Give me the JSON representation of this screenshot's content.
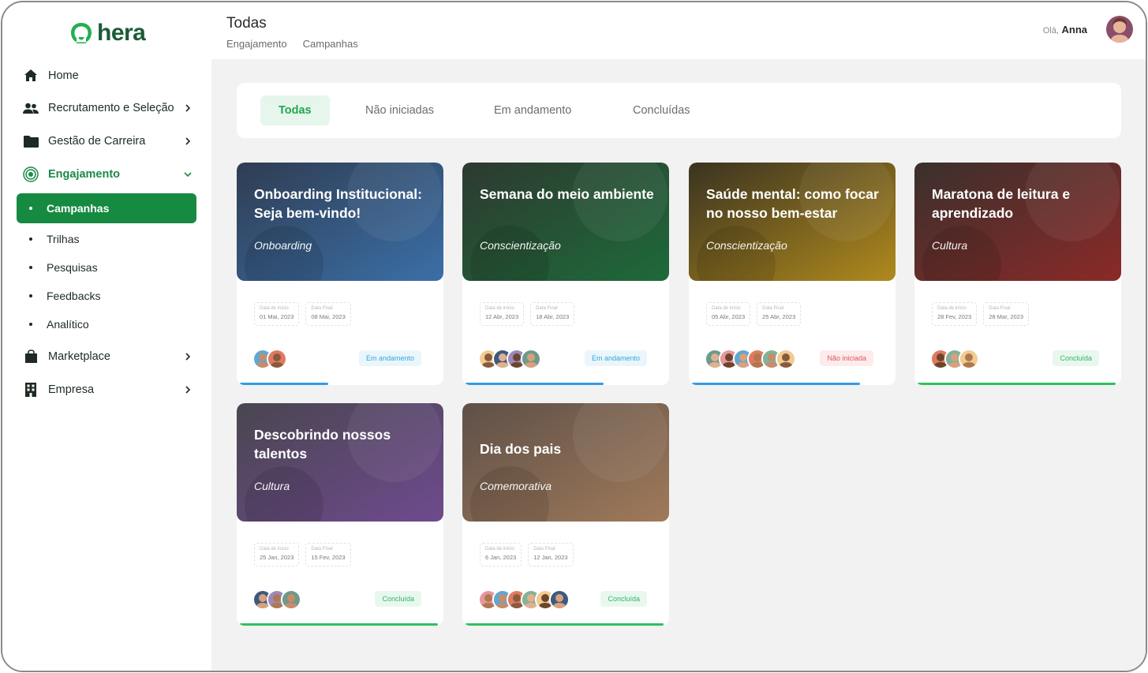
{
  "brand": {
    "name": "hera",
    "color": "#1a5c36",
    "accent": "#178a42"
  },
  "sidebar": {
    "items": [
      {
        "label": "Home",
        "icon": "home-icon"
      },
      {
        "label": "Recrutamento e Seleção",
        "icon": "users-icon"
      },
      {
        "label": "Gestão de Carreira",
        "icon": "folder-icon"
      },
      {
        "label": "Engajamento",
        "icon": "target-icon"
      },
      {
        "label": "Marketplace",
        "icon": "bag-icon"
      },
      {
        "label": "Empresa",
        "icon": "building-icon"
      }
    ],
    "subitems": [
      {
        "label": "Campanhas"
      },
      {
        "label": "Trilhas"
      },
      {
        "label": "Pesquisas"
      },
      {
        "label": "Feedbacks"
      },
      {
        "label": "Analítico"
      }
    ]
  },
  "header": {
    "title": "Todas",
    "breadcrumb": [
      "Engajamento",
      "Campanhas"
    ],
    "greeting_prefix": "Olá,",
    "user_name": "Anna"
  },
  "tabs": [
    "Todas",
    "Não iniciadas",
    "Em andamento",
    "Concluídas"
  ],
  "date_start_label": "Data de início",
  "date_end_label": "Data Final",
  "cards": [
    {
      "title": "Onboarding Institucional: Seja bem-vindo!",
      "category": "Onboarding",
      "start": "01 Mai, 2023",
      "end": "08 Mai, 2023",
      "status": "Em andamento",
      "progress": 0.44,
      "colors": [
        "#2f3d52",
        "#3b6fa8"
      ]
    },
    {
      "title": "Semana do meio ambiente",
      "category": "Conscientização",
      "start": "12 Abr, 2023",
      "end": "18 Abr, 2023",
      "status": "Em andamento",
      "progress": 0.69,
      "colors": [
        "#2d3a30",
        "#1e6a3a"
      ]
    },
    {
      "title": "Saúde mental: como focar no nosso bem-estar",
      "category": "Conscientização",
      "start": "05 Abr, 2023",
      "end": "25 Abr, 2023",
      "status": "Não iniciada",
      "progress": 0.84,
      "colors": [
        "#3a3320",
        "#b08a1e"
      ]
    },
    {
      "title": "Maratona de leitura e aprendizado",
      "category": "Cultura",
      "start": "28 Fev, 2023",
      "end": "28 Mar, 2023",
      "status": "Concluída",
      "progress": 0.99,
      "colors": [
        "#3a302c",
        "#8b2a28"
      ]
    },
    {
      "title": "Descobrindo nossos talentos",
      "category": "Cultura",
      "start": "25 Jan, 2023",
      "end": "15 Fev, 2023",
      "status": "Concluída",
      "progress": 0.99,
      "colors": [
        "#4a4650",
        "#6e4a8e"
      ]
    },
    {
      "title": "Dia dos pais",
      "category": "Comemorativa",
      "start": "6 Jan, 2023",
      "end": "12 Jan, 2023",
      "status": "Concluída",
      "progress": 0.99,
      "colors": [
        "#5e5048",
        "#a07a5a"
      ]
    }
  ]
}
